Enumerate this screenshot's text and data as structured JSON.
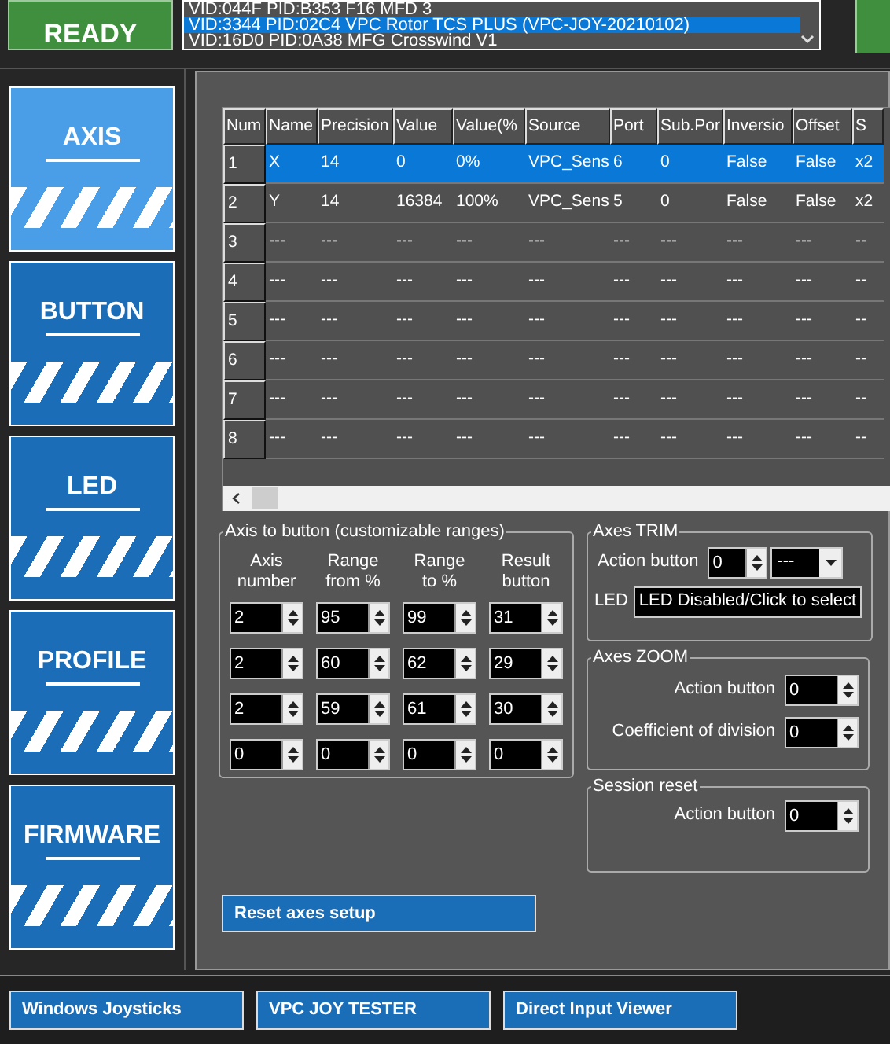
{
  "status_button": "READY",
  "device_list": [
    {
      "text": "VID:044F PID:B353 F16 MFD 3",
      "selected": false
    },
    {
      "text": "VID:3344 PID:02C4 VPC Rotor TCS PLUS (VPC-JOY-20210102)",
      "selected": true
    },
    {
      "text": "VID:16D0 PID:0A38 MFG Crosswind V1",
      "selected": false
    }
  ],
  "sidebar": [
    {
      "label": "AXIS",
      "selected": true
    },
    {
      "label": "BUTTON",
      "selected": false
    },
    {
      "label": "LED",
      "selected": false
    },
    {
      "label": "PROFILE",
      "selected": false
    },
    {
      "label": "FIRMWARE",
      "selected": false
    }
  ],
  "table": {
    "columns": [
      "Num",
      "Name",
      "Precision",
      "Value",
      "Value(%",
      "Source",
      "Port",
      "Sub.Por",
      "Inversio",
      "Offset",
      "S"
    ],
    "rows": [
      {
        "selected": true,
        "cells": [
          "1",
          "X",
          "14",
          "0",
          "0%",
          "VPC_Sens",
          "6",
          "0",
          "False",
          "False",
          "x2"
        ]
      },
      {
        "selected": false,
        "cells": [
          "2",
          "Y",
          "14",
          "16384",
          "100%",
          "VPC_Sens",
          "5",
          "0",
          "False",
          "False",
          "x2"
        ]
      },
      {
        "selected": false,
        "cells": [
          "3",
          "---",
          "---",
          "---",
          "---",
          "---",
          "---",
          "---",
          "---",
          "---",
          "--"
        ]
      },
      {
        "selected": false,
        "cells": [
          "4",
          "---",
          "---",
          "---",
          "---",
          "---",
          "---",
          "---",
          "---",
          "---",
          "--"
        ]
      },
      {
        "selected": false,
        "cells": [
          "5",
          "---",
          "---",
          "---",
          "---",
          "---",
          "---",
          "---",
          "---",
          "---",
          "--"
        ]
      },
      {
        "selected": false,
        "cells": [
          "6",
          "---",
          "---",
          "---",
          "---",
          "---",
          "---",
          "---",
          "---",
          "---",
          "--"
        ]
      },
      {
        "selected": false,
        "cells": [
          "7",
          "---",
          "---",
          "---",
          "---",
          "---",
          "---",
          "---",
          "---",
          "---",
          "--"
        ]
      },
      {
        "selected": false,
        "cells": [
          "8",
          "---",
          "---",
          "---",
          "---",
          "---",
          "---",
          "---",
          "---",
          "---",
          "--"
        ]
      }
    ]
  },
  "axis_to_button": {
    "title": "Axis to button (customizable ranges)",
    "headers": [
      [
        "Axis",
        "number"
      ],
      [
        "Range",
        "from %"
      ],
      [
        "Range",
        "to %"
      ],
      [
        "Result",
        "button"
      ]
    ],
    "rows": [
      [
        "2",
        "95",
        "99",
        "31"
      ],
      [
        "2",
        "60",
        "62",
        "29"
      ],
      [
        "2",
        "59",
        "61",
        "30"
      ],
      [
        "0",
        "0",
        "0",
        "0"
      ]
    ]
  },
  "axes_trim": {
    "title": "Axes TRIM",
    "action_label": "Action button",
    "action_value": "0",
    "dropdown_value": "---",
    "led_label": "LED",
    "led_button": "LED Disabled/Click to select"
  },
  "axes_zoom": {
    "title": "Axes ZOOM",
    "fields": [
      {
        "label": "Action button",
        "value": "0"
      },
      {
        "label": "Coefficient of division",
        "value": "0"
      }
    ]
  },
  "session_reset": {
    "title": "Session reset",
    "fields": [
      {
        "label": "Action button",
        "value": "0"
      }
    ]
  },
  "reset_button": "Reset axes setup",
  "bottom_buttons": [
    "Windows Joysticks",
    "VPC JOY TESTER",
    "Direct Input Viewer"
  ]
}
